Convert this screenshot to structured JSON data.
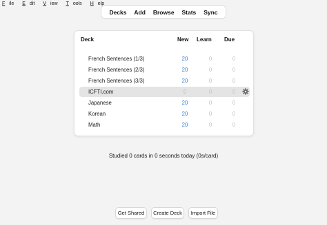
{
  "menu": {
    "items": [
      {
        "accel": "F",
        "rest": "ile"
      },
      {
        "accel": "E",
        "rest": "dit"
      },
      {
        "accel": "V",
        "rest": "iew"
      },
      {
        "accel": "T",
        "rest": "ools"
      },
      {
        "accel": "H",
        "rest": "elp"
      }
    ]
  },
  "toolbar": {
    "decks": "Decks",
    "add": "Add",
    "browse": "Browse",
    "stats": "Stats",
    "sync": "Sync"
  },
  "table": {
    "headers": {
      "deck": "Deck",
      "new": "New",
      "learn": "Learn",
      "due": "Due"
    },
    "rows": [
      {
        "name": "French Sentences (1/3)",
        "new": "20",
        "learn": "0",
        "due": "0"
      },
      {
        "name": "French Sentences (2/3)",
        "new": "20",
        "learn": "0",
        "due": "0"
      },
      {
        "name": "French Sentences (3/3)",
        "new": "20",
        "learn": "0",
        "due": "0"
      },
      {
        "name": "ICFTI.com",
        "new": "0",
        "learn": "0",
        "due": "0"
      },
      {
        "name": "Japanese",
        "new": "20",
        "learn": "0",
        "due": "0"
      },
      {
        "name": "Korean",
        "new": "20",
        "learn": "0",
        "due": "0"
      },
      {
        "name": "Math",
        "new": "20",
        "learn": "0",
        "due": "0"
      }
    ]
  },
  "studied_text": "Studied 0 cards in 0 seconds today (0s/card)",
  "buttons": {
    "get_shared": "Get Shared",
    "create_deck": "Create Deck",
    "import_file": "Import File"
  },
  "colors": {
    "new_count": "#3b82d6",
    "zero_count": "#c2c2c2",
    "selected_row": "#e4e4e4"
  }
}
